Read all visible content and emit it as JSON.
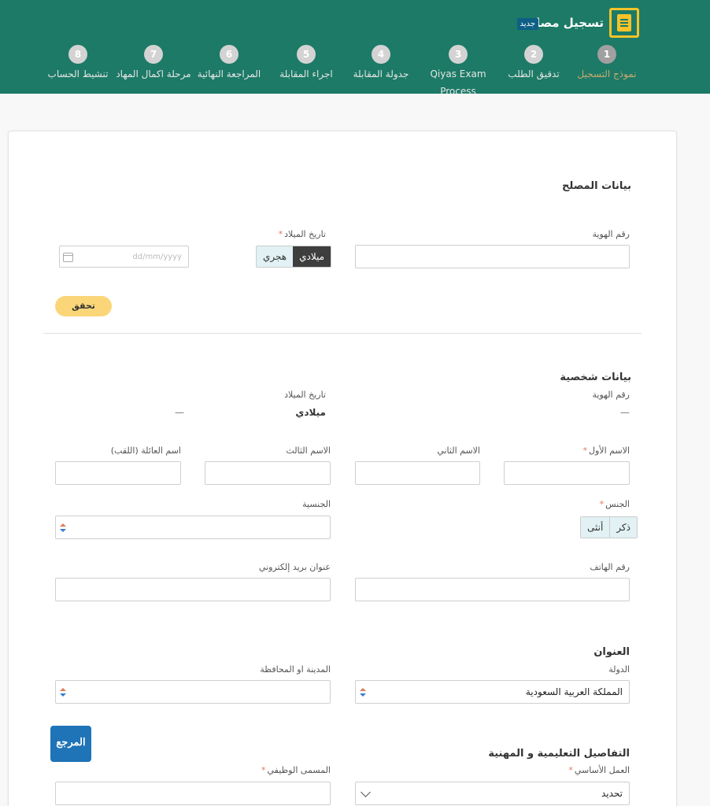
{
  "header": {
    "title": "تسجيل مصلح",
    "badge": "جديد",
    "steps": [
      {
        "num": "1",
        "label": "نموذج التسجيل",
        "active": true
      },
      {
        "num": "2",
        "label": "تدقيق الطلب"
      },
      {
        "num": "3",
        "label": "Qiyas Exam Process"
      },
      {
        "num": "4",
        "label": "جدولة المقابلة"
      },
      {
        "num": "5",
        "label": "اجراء المقابلة"
      },
      {
        "num": "6",
        "label": "المراجعة النهائية"
      },
      {
        "num": "7",
        "label": "مرحلة اكمال المهاد"
      },
      {
        "num": "8",
        "label": "تنشيط الحساب"
      }
    ]
  },
  "repairer": {
    "title": "بيانات المصلح",
    "id_label": "رقم الهوية",
    "dob_label": "تاريخ الميلاد",
    "required_mark": "*",
    "calendar_options": [
      "ميلادي",
      "هجري"
    ],
    "date_placeholder": "dd/mm/yyyy",
    "verify_label": "تحقق"
  },
  "personal": {
    "title": "بيانات شخصية",
    "id_label": "رقم الهوية",
    "id_value": "—",
    "dob_label": "تاريخ الميلاد",
    "dob_value": "ميلادي",
    "dob_dash": "—",
    "first_name": "الاسم الأول",
    "second_name": "الاسم الثاني",
    "third_name": "الاسم الثالث",
    "family_name": "اسم العائلة (اللقب)",
    "gender_label": "الجنس",
    "gender_options": [
      "ذكر",
      "أنثى"
    ],
    "nationality_label": "الجنسية",
    "phone_label": "رقم الهاتف",
    "email_label": "عنوان بريد إلكتروني"
  },
  "address": {
    "title": "العنوان",
    "country_label": "الدولة",
    "country_value": "المملكة العربية السعودية",
    "city_label": "المدينة او المحافظة"
  },
  "education": {
    "title": "التفاصيل التعليمية و المهنية",
    "primary_work_label": "العمل الأساسي",
    "primary_work_value": "تحديد",
    "job_title_label": "المسمى الوظيفي"
  },
  "logo_text": "المرجع",
  "colors": {
    "header": "#1c7a66",
    "accent": "#f6c32a",
    "button": "#fbd679"
  }
}
